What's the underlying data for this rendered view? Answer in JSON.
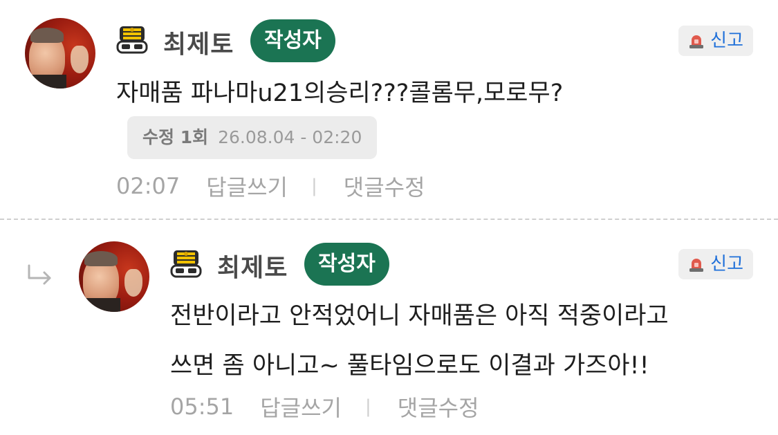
{
  "comments": [
    {
      "author": "최제토",
      "author_tag": "작성자",
      "report_label": "신고",
      "text_lines": [
        "자매품 파나마u21의승리???콜롬무,모로무?"
      ],
      "edit_info": {
        "label": "수정 1회",
        "datetime": "26.08.04 - 02:20"
      },
      "time": "02:07",
      "reply_label": "답글쓰기",
      "edit_label": "댓글수정",
      "separator": "|"
    },
    {
      "author": "최제토",
      "author_tag": "작성자",
      "report_label": "신고",
      "text_lines": [
        "전반이라고 안적었어니 자매품은 아직 적중이라고",
        "쓰면 좀 아니고~ 풀타임으로도 이결과 가즈아!!"
      ],
      "time": "05:51",
      "reply_label": "답글쓰기",
      "edit_label": "댓글수정",
      "separator": "|"
    }
  ],
  "icons": {
    "avatar": "profile-photo",
    "badge": "military-rank-badge-icon",
    "report": "siren-icon",
    "reply": "reply-arrow-icon"
  },
  "colors": {
    "author_tag_bg": "#1b7453",
    "report_text": "#1e6fd9",
    "meta_text": "#a5a5a5"
  }
}
